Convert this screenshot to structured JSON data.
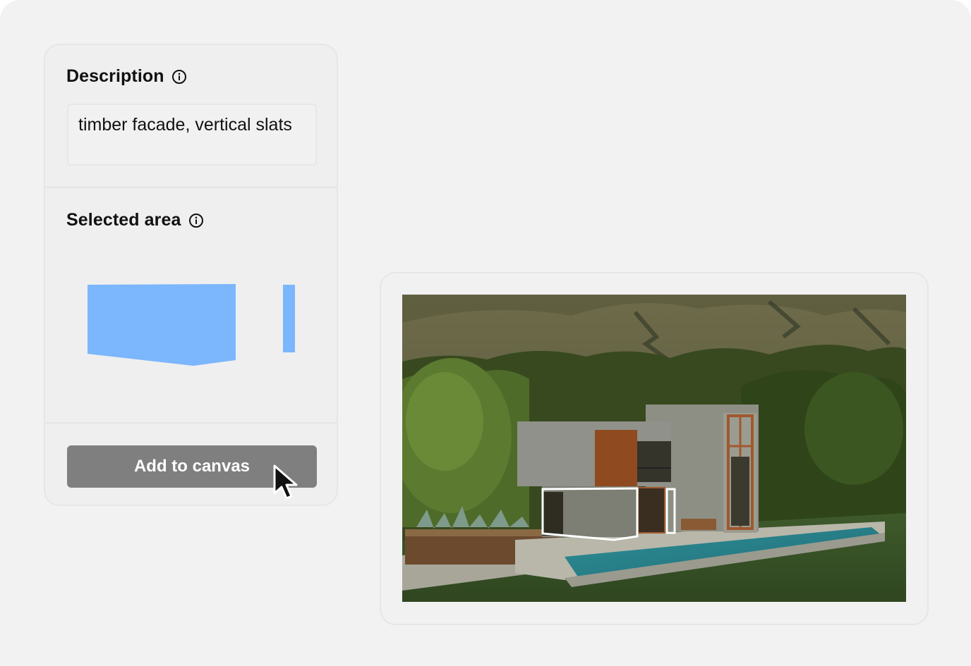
{
  "description": {
    "title": "Description",
    "info_icon": "info-icon",
    "value": "timber facade, vertical slats"
  },
  "selected_area": {
    "title": "Selected area",
    "info_icon": "info-icon",
    "mask_color": "#7cb6fd"
  },
  "actions": {
    "add_label": "Add to canvas",
    "button_color": "#7f7f7f"
  },
  "cursor_icon": "pointer-cursor-icon",
  "image": {
    "subject": "house-render-image",
    "selection_outline_color": "#ffffff"
  }
}
